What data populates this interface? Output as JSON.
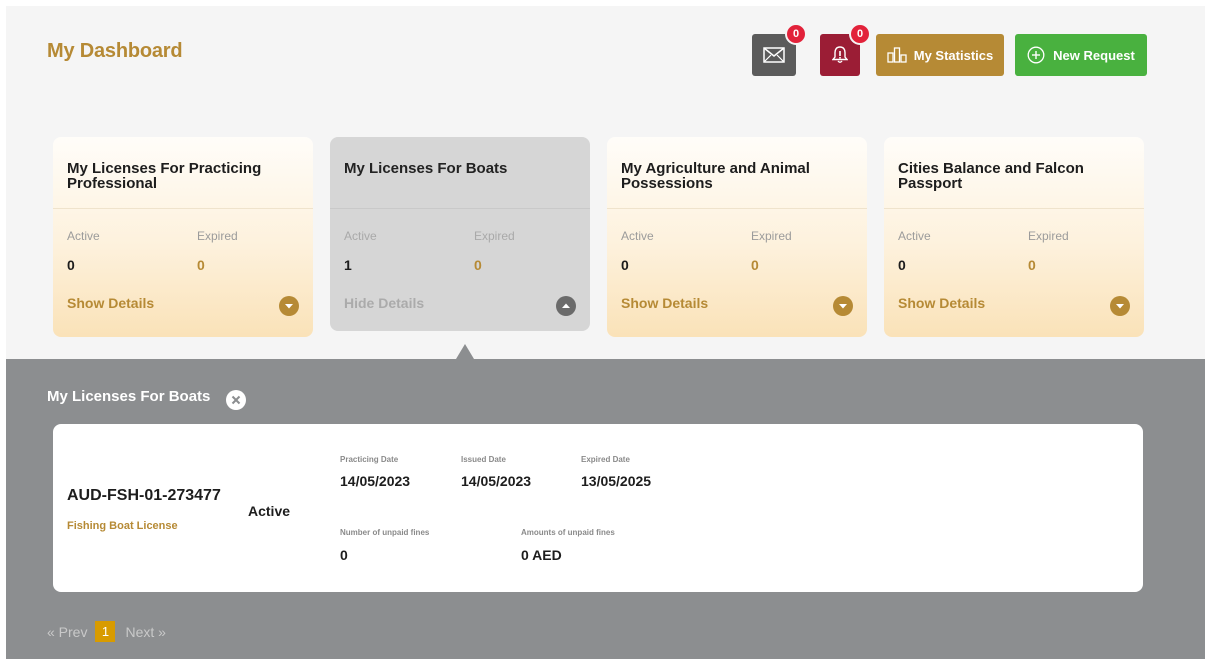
{
  "header": {
    "title": "My Dashboard",
    "mail": {
      "icon": "mail-icon",
      "badge": "0"
    },
    "notifications": {
      "icon": "bell-icon",
      "badge": "0"
    },
    "statistics_label": "My Statistics",
    "new_request_label": "New Request"
  },
  "cards": [
    {
      "title": "My Licenses For Practicing Professional",
      "active_label": "Active",
      "active_value": "0",
      "expired_label": "Expired",
      "expired_value": "0",
      "details_label": "Show Details",
      "selected": false
    },
    {
      "title": "My Licenses For Boats",
      "active_label": "Active",
      "active_value": "1",
      "expired_label": "Expired",
      "expired_value": "0",
      "details_label": "Hide Details",
      "selected": true
    },
    {
      "title": "My Agriculture and Animal Possessions",
      "active_label": "Active",
      "active_value": "0",
      "expired_label": "Expired",
      "expired_value": "0",
      "details_label": "Show Details",
      "selected": false
    },
    {
      "title": "Cities Balance and Falcon Passport",
      "active_label": "Active",
      "active_value": "0",
      "expired_label": "Expired",
      "expired_value": "0",
      "details_label": "Show Details",
      "selected": false
    }
  ],
  "panel": {
    "title": "My Licenses For Boats",
    "license": {
      "number": "AUD-FSH-01-273477",
      "type": "Fishing Boat License",
      "status": "Active",
      "practicing_date_label": "Practicing Date",
      "practicing_date": "14/05/2023",
      "issued_date_label": "Issued Date",
      "issued_date": "14/05/2023",
      "expired_date_label": "Expired Date",
      "expired_date": "13/05/2025",
      "unpaid_fines_count_label": "Number of unpaid fines",
      "unpaid_fines_count": "0",
      "unpaid_fines_amount_label": "Amounts of unpaid fines",
      "unpaid_fines_amount": "0 AED"
    },
    "pagination": {
      "prev": "« Prev",
      "current": "1",
      "next": "Next »"
    }
  },
  "colors": {
    "gold": "#b68a35",
    "green": "#49b13f",
    "maroon": "#9b1d35",
    "panel": "#8c8e90",
    "page_active": "#d89b00"
  }
}
